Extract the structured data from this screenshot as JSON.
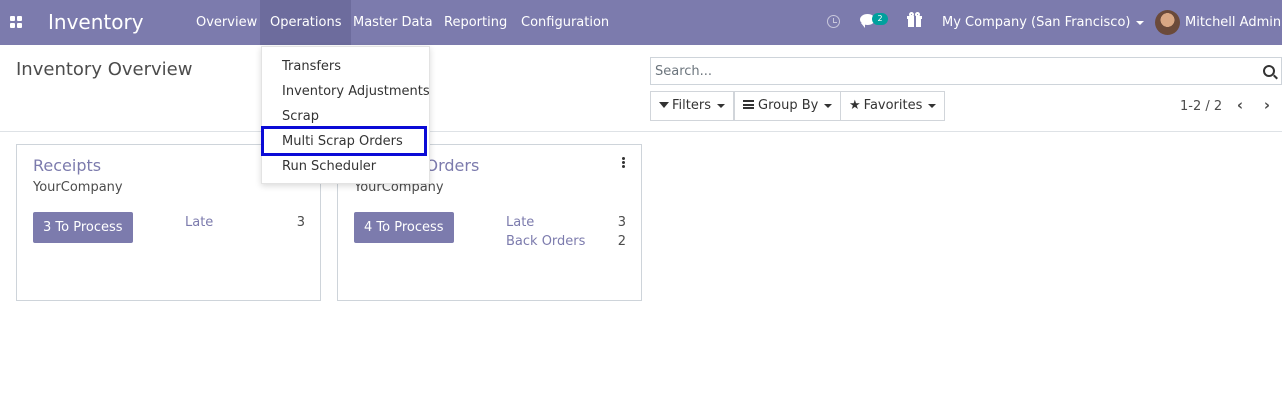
{
  "navbar": {
    "app_title": "Inventory",
    "menu": [
      "Overview",
      "Operations",
      "Master Data",
      "Reporting",
      "Configuration"
    ],
    "active_menu": "Operations",
    "chat_count": "2",
    "company": "My Company (San Francisco)",
    "user": "Mitchell Admin",
    "bg_color": "#7c7bad"
  },
  "operations_menu": {
    "items": [
      "Transfers",
      "Inventory Adjustments",
      "Scrap",
      "Multi Scrap Orders",
      "Run Scheduler"
    ],
    "highlighted": "Multi Scrap Orders"
  },
  "control_panel": {
    "title": "Inventory Overview",
    "search_placeholder": "Search...",
    "filters_label": "Filters",
    "group_by_label": "Group By",
    "favorites_label": "Favorites",
    "pager": "1-2 / 2"
  },
  "cards": [
    {
      "title": "Receipts",
      "company": "YourCompany",
      "process_button": "3 To Process",
      "stats": [
        {
          "label": "Late",
          "value": "3"
        }
      ]
    },
    {
      "title": "Delivery Orders",
      "company": "YourCompany",
      "process_button": "4 To Process",
      "stats": [
        {
          "label": "Late",
          "value": "3"
        },
        {
          "label": "Back Orders",
          "value": "2"
        }
      ]
    }
  ]
}
